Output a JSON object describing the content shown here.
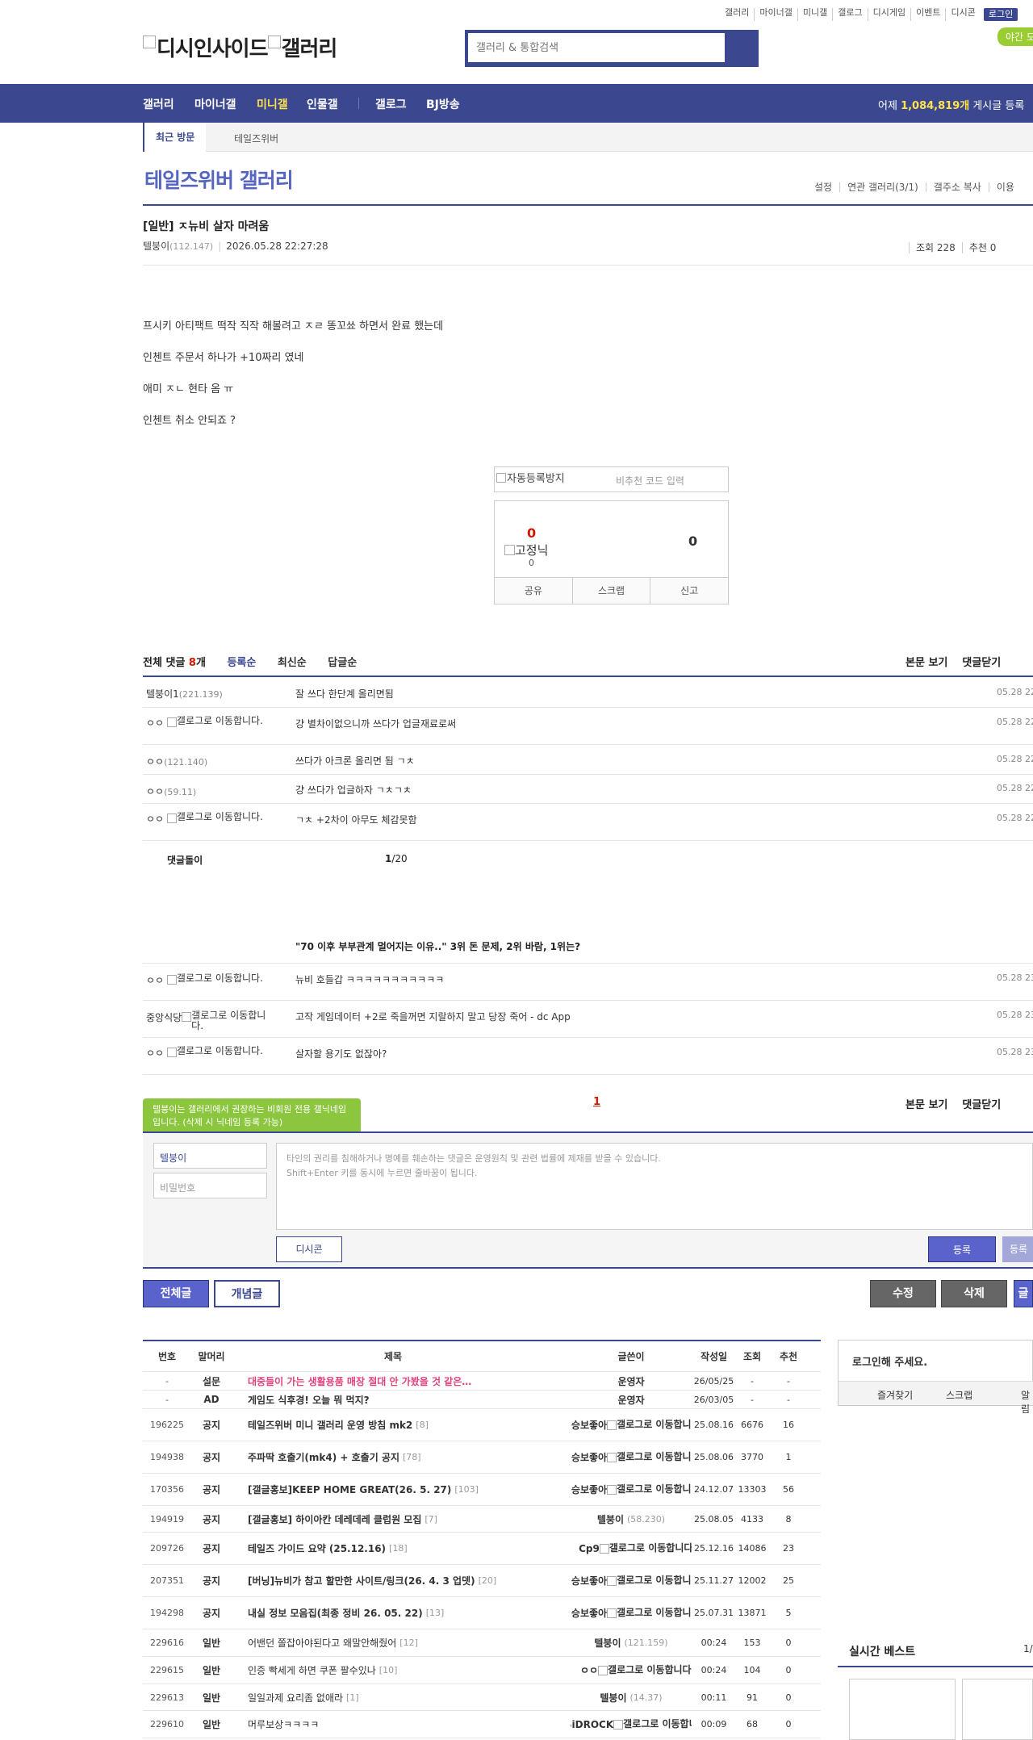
{
  "util_links": [
    "갤러리",
    "마이너갤",
    "미니갤",
    "갤로그",
    "디시게임",
    "이벤트",
    "디시콘"
  ],
  "login_label": "로그인",
  "night_label": "야간 모",
  "logo_alt": "디시인사이드",
  "logo_alt2": "갤러리",
  "search_placeholder": "갤러리 & 통합검색",
  "gnb": [
    "갤러리",
    "마이너갤",
    "미니갤",
    "인물갤",
    "갤로그",
    "BJ방송"
  ],
  "stat_prefix": "어제 ",
  "stat_count": "1,084,819개",
  "stat_suffix": " 게시글 등록",
  "lnb_recent": "최근 방문",
  "lnb_gallery": "테일즈위버",
  "gallery_title": "테일즈위버 갤러리",
  "gallery_menu": [
    "설정",
    "연관 갤러리(3/1)",
    "갤주소 복사",
    "이용"
  ],
  "post": {
    "title": "[일반] ㅈ뉴비 살자 마려움",
    "author": "텔붕이",
    "author_ip": "(112.147)",
    "date": "2026.05.28 22:27:28",
    "views": "조회 228",
    "recommend": "추천 0",
    "body": [
      "프시키 아티팩트 떡작 직작 해볼려고 ㅈㄹ 똥꼬쑈 하면서 완료 했는데",
      "인첸트 주문서 하나가 +10짜리 였네",
      "애미 ㅈㄴ 현타 옴 ㅠ",
      "인첸트 취소 안되죠 ?"
    ]
  },
  "captcha_alt": "자동등록방지",
  "captcha_placeholder": "비추천 코드 입력",
  "rec_up": "0",
  "fix_alt": "고정닉",
  "fix_count": "0",
  "rec_down": "0",
  "rec_btns": [
    "공유",
    "스크랩",
    "신고"
  ],
  "comments_head": {
    "all": "전체 댓글 ",
    "count": "8",
    "unit": "개",
    "sorts": [
      "등록순",
      "최신순",
      "답글순"
    ]
  },
  "cmt_tools": [
    "본문 보기",
    "댓글닫기"
  ],
  "gallog_alt": "갤로그로 이동합니다.",
  "comments": [
    {
      "nick": "텔붕이1",
      "ip": "(221.139)",
      "text": "잘 쓰다 한단계 올리면됨",
      "date": "05.28 22"
    },
    {
      "nick": "ㅇㅇ",
      "ip": "",
      "text": "걍 별차이없으니까 쓰다가 업글재료로써",
      "date": "05.28 22"
    },
    {
      "nick": "ㅇㅇ",
      "ip": "(121.140)",
      "text": "쓰다가 아크론 올리면 됨 ㄱㅊ",
      "date": "05.28 22"
    },
    {
      "nick": "ㅇㅇ",
      "ip": "(59.11)",
      "text": "걍 쓰다가 업글하자 ㄱㅊㄱㅊ",
      "date": "05.28 22"
    },
    {
      "nick": "ㅇㅇ",
      "ip": "",
      "text": "ㄱㅊ +2차이 아무도 체감못함",
      "date": "05.28 22"
    }
  ],
  "dolls_label": "댓글돌이",
  "dolls_page": "1",
  "dolls_total": "/20",
  "ad_title": "\"70 이후 부부관계 멀어지는 이유..\" 3위 돈 문제, 2위 바람, 1위는?",
  "comments2": [
    {
      "nick": "ㅇㅇ",
      "text": "뉴비 호들갑 ㅋㅋㅋㅋㅋㅋㅋㅋㅋㅋㅋ",
      "date": "05.28 23"
    },
    {
      "nick": "중앙식당",
      "text": "고작 게임데이터 +2로 죽을꺼면 지랄하지 말고 당장 죽어 - dc App",
      "date": "05.28 23"
    },
    {
      "nick": "ㅇㅇ",
      "text": "살자할 용기도 없잖아?",
      "date": "05.28 23"
    }
  ],
  "tip": "텔붕이는 갤러리에서 권장하는 비회원 전용 갤닉네임입니다. (삭제 시 닉네임 등록 가능)",
  "cmt_page": "1",
  "write": {
    "nick_value": "텔붕이",
    "pw_placeholder": "비밀번호",
    "textarea_line1": "타인의 권리를 침해하거나 명예를 훼손하는 댓글은 운영원칙 및 관련 법률에 제재를 받을 수 있습니다.",
    "textarea_line2": "Shift+Enter 키를 동시에 누르면 줄바꿈이 됩니다.",
    "dccon": "디시콘",
    "submit": "등록",
    "submit2": "등록"
  },
  "list_btns": {
    "all": "전체글",
    "concept": "개념글",
    "edit": "수정",
    "delete": "삭제",
    "write": "글"
  },
  "table_head": [
    "번호",
    "말머리",
    "제목",
    "글쓴이",
    "작성일",
    "조회",
    "추천"
  ],
  "rows": [
    {
      "no": "-",
      "head": "설문",
      "title": "대중들이 가는 생활용품 매장 절대 안 가봤을 것 같은…",
      "rc": "",
      "writer": "운영자",
      "wip": "",
      "gallog": false,
      "date": "26/05/25",
      "views": "-",
      "rec": "-",
      "style": "red"
    },
    {
      "no": "-",
      "head": "AD",
      "title": "게임도 식후경! 오늘 뭐 먹지?",
      "rc": "",
      "writer": "운영자",
      "wip": "",
      "gallog": false,
      "date": "26/03/05",
      "views": "-",
      "rec": "-",
      "style": "bold"
    },
    {
      "no": "196225",
      "head": "공지",
      "title": "테일즈위버 미니 갤러리 운영 방침 mk2",
      "rc": "[8]",
      "writer": "승보좋아",
      "wip": "",
      "gallog": true,
      "date": "25.08.16",
      "views": "6676",
      "rec": "16",
      "style": "bold"
    },
    {
      "no": "194938",
      "head": "공지",
      "title": "주파딱 호출기(mk4) + 호출기 공지",
      "rc": "[78]",
      "writer": "승보좋아",
      "wip": "",
      "gallog": true,
      "date": "25.08.06",
      "views": "3770",
      "rec": "1",
      "style": "bold"
    },
    {
      "no": "170356",
      "head": "공지",
      "title": "[갤글홍보]KEEP HOME GREAT(26. 5. 27)",
      "rc": "[103]",
      "writer": "승보좋아",
      "wip": "",
      "gallog": true,
      "date": "24.12.07",
      "views": "13303",
      "rec": "56",
      "style": "bold"
    },
    {
      "no": "194919",
      "head": "공지",
      "title": "[갤글홍보] 하이아칸 데레데레 클럽원 모집",
      "rc": "[7]",
      "writer": "텔붕이",
      "wip": "(58.230)",
      "gallog": false,
      "date": "25.08.05",
      "views": "4133",
      "rec": "8",
      "style": "bold"
    },
    {
      "no": "209726",
      "head": "공지",
      "title": "테일즈 가이드 요약 (25.12.16)",
      "rc": "[18]",
      "writer": "Cp9",
      "wip": "",
      "gallog": true,
      "date": "25.12.16",
      "views": "14086",
      "rec": "23",
      "style": "bold"
    },
    {
      "no": "207351",
      "head": "공지",
      "title": "[버닝]뉴비가 참고 할만한 사이트/링크(26. 4. 3 업뎃)",
      "rc": "[20]",
      "writer": "승보좋아",
      "wip": "",
      "gallog": true,
      "date": "25.11.27",
      "views": "12002",
      "rec": "25",
      "style": "bold"
    },
    {
      "no": "194298",
      "head": "공지",
      "title": "내실 정보 모음집(최종 정비 26. 05. 22)",
      "rc": "[13]",
      "writer": "승보좋아",
      "wip": "",
      "gallog": true,
      "date": "25.07.31",
      "views": "13871",
      "rec": "5",
      "style": "bold"
    },
    {
      "no": "229616",
      "head": "일반",
      "title": "어밴던 쫄잡아야된다고 왜말안해줬어",
      "rc": "[12]",
      "writer": "텔붕이",
      "wip": "(121.159)",
      "gallog": false,
      "date": "00:24",
      "views": "153",
      "rec": "0",
      "style": "normal"
    },
    {
      "no": "229615",
      "head": "일반",
      "title": "인증 빡세게 하면 쿠폰 팔수있나",
      "rc": "[10]",
      "writer": "ㅇㅇ",
      "wip": "",
      "gallog": true,
      "date": "00:24",
      "views": "104",
      "rec": "0",
      "style": "normal"
    },
    {
      "no": "229613",
      "head": "일반",
      "title": "일일과제 요리좀 없애라",
      "rc": "[1]",
      "writer": "텔붕이",
      "wip": "(14.37)",
      "gallog": false,
      "date": "00:11",
      "views": "91",
      "rec": "0",
      "style": "normal"
    },
    {
      "no": "229610",
      "head": "일반",
      "title": "머루보상ㅋㅋㅋㅋ",
      "rc": "",
      "writer": "SiDROCK",
      "wip": "",
      "gallog": true,
      "date": "00:09",
      "views": "68",
      "rec": "0",
      "style": "normal"
    }
  ],
  "side": {
    "login_text": "로그인해 주세요.",
    "links": [
      "즐겨찾기",
      "스크랩",
      "알림"
    ],
    "best_title": "실시간 베스트",
    "best_page": "1/"
  }
}
